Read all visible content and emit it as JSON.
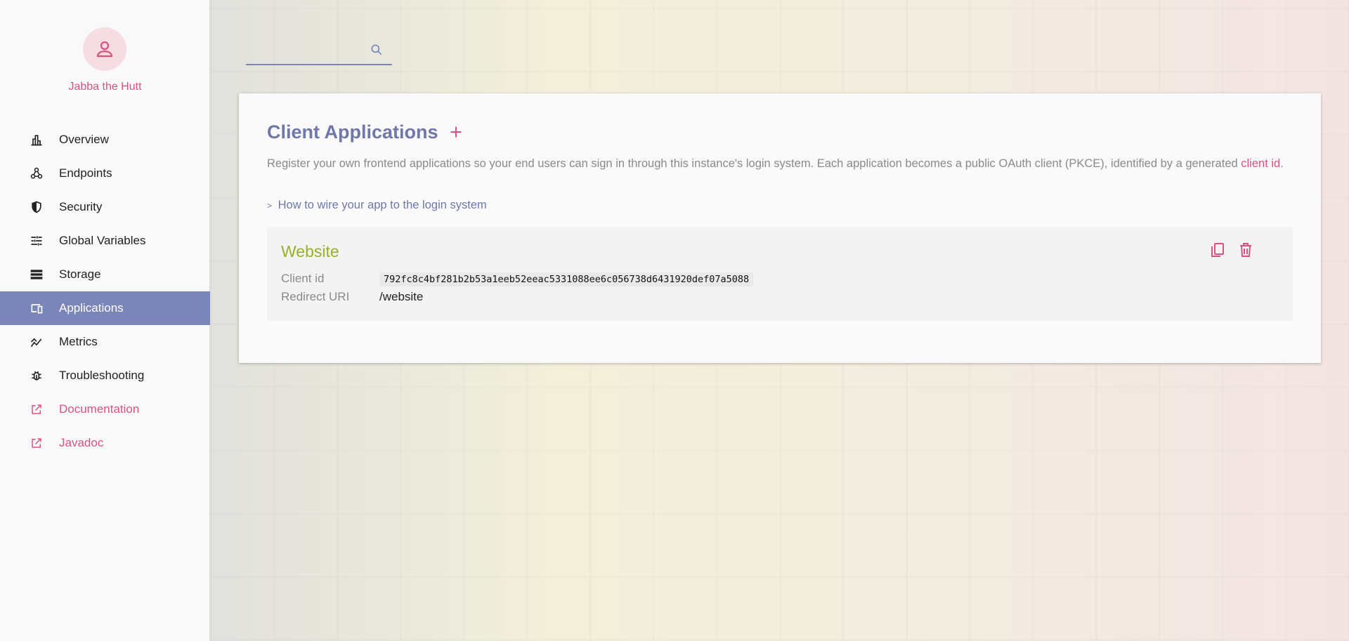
{
  "user": {
    "name": "Jabba the Hutt",
    "avatar_icon": "person-icon"
  },
  "nav": {
    "items": [
      {
        "label": "Overview",
        "icon": "bar-chart-icon"
      },
      {
        "label": "Endpoints",
        "icon": "webhook-icon"
      },
      {
        "label": "Security",
        "icon": "shield-icon"
      },
      {
        "label": "Global Variables",
        "icon": "tune-icon"
      },
      {
        "label": "Storage",
        "icon": "storage-icon"
      },
      {
        "label": "Applications",
        "icon": "devices-icon",
        "active": true
      },
      {
        "label": "Metrics",
        "icon": "line-chart-icon"
      },
      {
        "label": "Troubleshooting",
        "icon": "bug-icon"
      },
      {
        "label": "Documentation",
        "icon": "external-link-icon"
      },
      {
        "label": "Javadoc",
        "icon": "external-link-icon"
      }
    ]
  },
  "search": {
    "value": "",
    "placeholder": ""
  },
  "page": {
    "title": "Client Applications",
    "description": "Register your own frontend applications so your end users can sign in through this instance's login system. Each application becomes a public OAuth client (PKCE), identified by a generated",
    "description_link": "client id",
    "description_end": ".",
    "howto_prefix": ">",
    "howto_label": "How to wire your app to the login system"
  },
  "apps": [
    {
      "name": "Website",
      "client_id_label": "Client id",
      "client_id": "792fc8c4bf281b2b53a1eeb52eeac5331088ee6c056738d6431920def07a5088",
      "redirect_label": "Redirect URI",
      "redirect_uri": "/website"
    }
  ],
  "colors": {
    "accent": "#7b86b8",
    "pink": "#d9527e",
    "app_title": "#9bb024"
  }
}
